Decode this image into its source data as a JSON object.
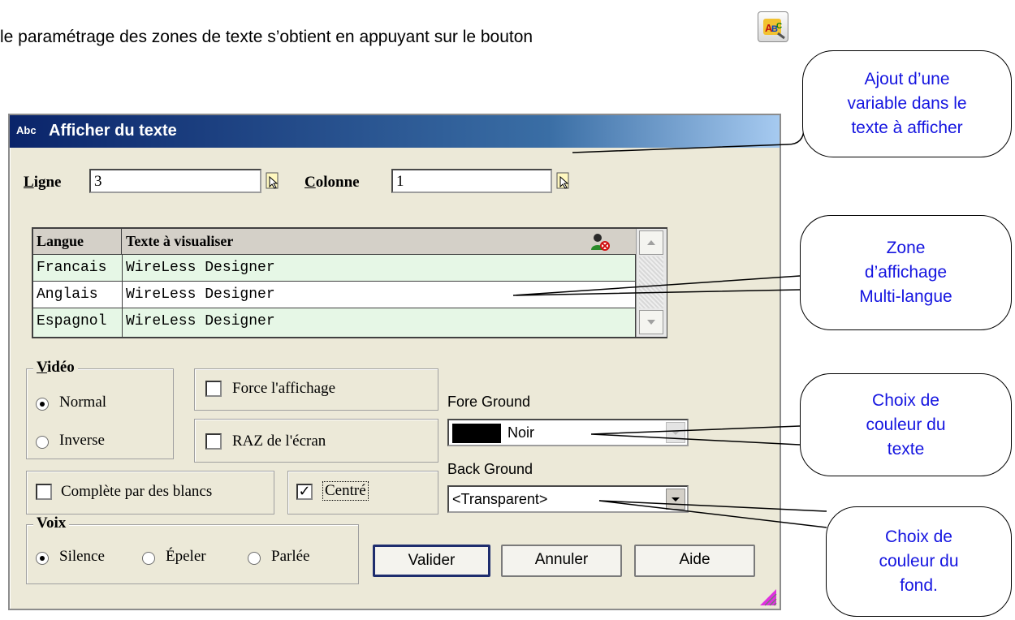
{
  "intro": {
    "text": "le paramétrage des zones de texte s’obtient en appuyant sur le bouton"
  },
  "dialog": {
    "icon_label": "Abc",
    "title": "Afficher du texte",
    "ligne": {
      "label_ul": "L",
      "label_rest": "igne",
      "value": "3"
    },
    "colonne": {
      "label_ul": "C",
      "label_rest": "olonne",
      "value": "1"
    },
    "table": {
      "columns": [
        "Langue",
        "Texte à visualiser"
      ],
      "rows": [
        {
          "langue": "Francais",
          "texte": "WireLess Designer",
          "bg": "#e6f7e6"
        },
        {
          "langue": "Anglais",
          "texte": "WireLess Designer",
          "bg": "#ffffff"
        },
        {
          "langue": "Espagnol",
          "texte": "WireLess Designer",
          "bg": "#e6f7e6"
        }
      ]
    },
    "video": {
      "legend_ul": "V",
      "legend_rest": "idéo",
      "options": [
        "Normal",
        "Inverse"
      ],
      "selected": "Normal"
    },
    "checkboxes": {
      "force": "Force l'affichage",
      "raz": "RAZ de l'écran",
      "complete": "Complète par des blancs",
      "centre": "Centré"
    },
    "fore_ground": {
      "label": "Fore Ground",
      "value": "Noir",
      "swatch": "#000000"
    },
    "back_ground": {
      "label": "Back Ground",
      "value": "<Transparent>"
    },
    "voix": {
      "legend": "Voix",
      "options": [
        "Silence",
        "Épeler",
        "Parlée"
      ],
      "selected": "Silence"
    },
    "buttons": {
      "valider": "Valider",
      "annuler": "Annuler",
      "aide": "Aide"
    }
  },
  "callouts": {
    "variable": {
      "l1": "Ajout d’une",
      "l2": "variable dans le",
      "l3": "texte à afficher"
    },
    "multilangue": {
      "l1": "Zone",
      "l2": "d’affichage",
      "l3": "Multi-langue"
    },
    "couleur_texte": {
      "l1": "Choix de",
      "l2": "couleur du",
      "l3": "texte"
    },
    "couleur_fond": {
      "l1": "Choix de",
      "l2": "couleur du",
      "l3": "fond."
    }
  },
  "colors": {
    "accent_text": "#1515e0",
    "title_bar": "#0a246a",
    "dialog_bg": "#ece9d8"
  }
}
